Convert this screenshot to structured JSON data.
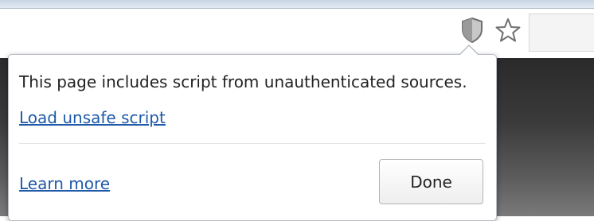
{
  "toolbar": {
    "shield_icon": "shield-warning-icon",
    "star_icon": "bookmark-star-icon"
  },
  "bubble": {
    "message": "This page includes script from unauthenticated sources.",
    "load_unsafe_link": "Load unsafe script",
    "learn_more_link": "Learn more",
    "done_button": "Done"
  },
  "colors": {
    "link": "#1e5aa8",
    "text": "#222222",
    "page_background": "#2a2a2a"
  }
}
